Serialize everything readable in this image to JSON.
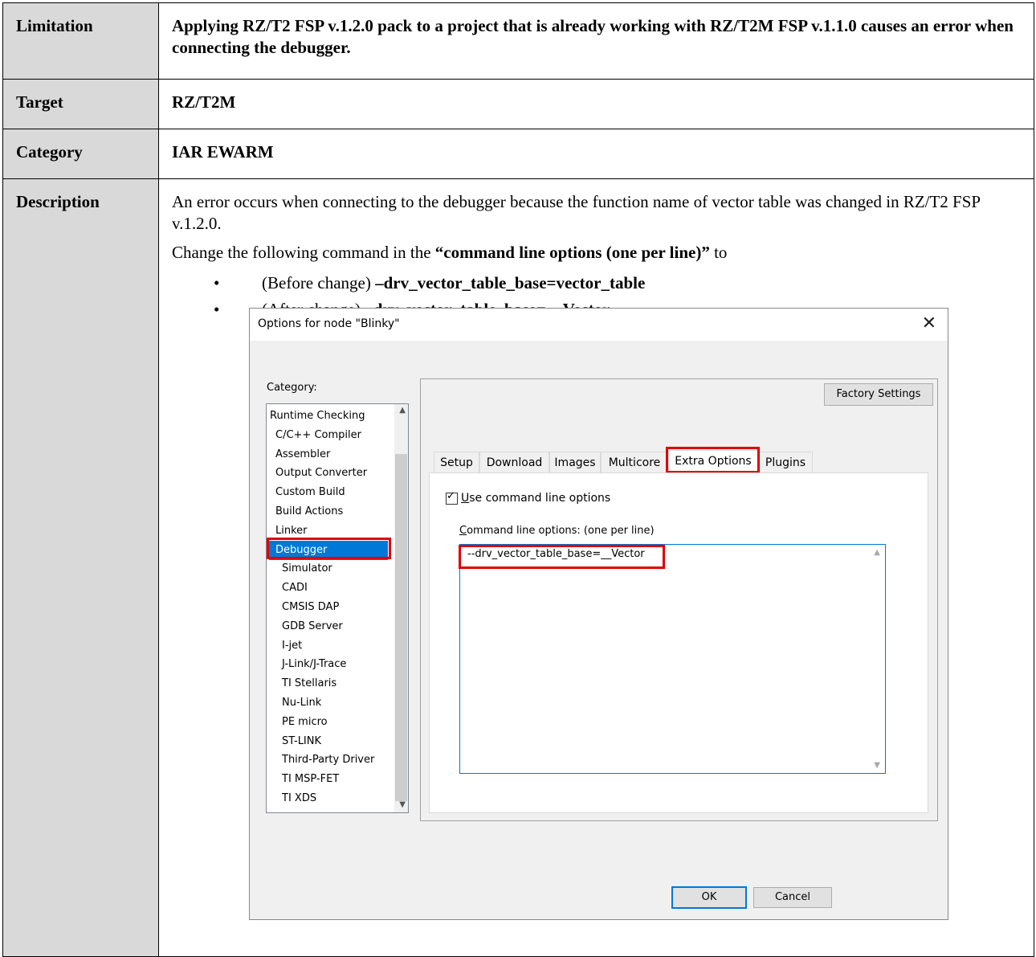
{
  "table": {
    "limitation": {
      "label": "Limitation",
      "value": "Applying RZ/T2 FSP v.1.2.0 pack to a project that is already working with RZ/T2M FSP v.1.1.0 causes an error when connecting the debugger."
    },
    "target": {
      "label": "Target",
      "value": "RZ/T2M"
    },
    "category": {
      "label": "Category",
      "value": "IAR EWARM"
    },
    "description": {
      "label": "Description",
      "para1": "An error occurs when connecting to the debugger because the function name of vector table was changed in RZ/T2 FSP v.1.2.0.",
      "para2_prefix": "Change the following command in the ",
      "para2_bold": "“command line options (one per line)”",
      "para2_suffix": " to",
      "bullets": [
        {
          "prefix": "(Before change) ",
          "bold": "–drv_vector_table_base=vector_table"
        },
        {
          "prefix": "(After change) ",
          "bold": "–drv_vector_table_base=__Vector"
        }
      ]
    }
  },
  "dialog": {
    "title": "Options for node \"Blinky\"",
    "close_glyph": "✕",
    "category_label": "Category:",
    "categories": [
      {
        "label": "Runtime Checking",
        "level": 0
      },
      {
        "label": "C/C++ Compiler",
        "level": 1
      },
      {
        "label": "Assembler",
        "level": 1
      },
      {
        "label": "Output Converter",
        "level": 1
      },
      {
        "label": "Custom Build",
        "level": 1
      },
      {
        "label": "Build Actions",
        "level": 1
      },
      {
        "label": "Linker",
        "level": 1
      },
      {
        "label": "Debugger",
        "level": 1,
        "selected": true
      },
      {
        "label": "Simulator",
        "level": 2
      },
      {
        "label": "CADI",
        "level": 2
      },
      {
        "label": "CMSIS DAP",
        "level": 2
      },
      {
        "label": "GDB Server",
        "level": 2
      },
      {
        "label": "I-jet",
        "level": 2
      },
      {
        "label": "J-Link/J-Trace",
        "level": 2
      },
      {
        "label": "TI Stellaris",
        "level": 2
      },
      {
        "label": "Nu-Link",
        "level": 2
      },
      {
        "label": "PE micro",
        "level": 2
      },
      {
        "label": "ST-LINK",
        "level": 2
      },
      {
        "label": "Third-Party Driver",
        "level": 2
      },
      {
        "label": "TI MSP-FET",
        "level": 2
      },
      {
        "label": "TI XDS",
        "level": 2
      }
    ],
    "factory_settings": "Factory Settings",
    "tabs": [
      "Setup",
      "Download",
      "Images",
      "Multicore",
      "Extra Options",
      "Plugins"
    ],
    "active_tab": "Extra Options",
    "use_cmd_line_u": "U",
    "use_cmd_line_rest": "se command line options",
    "cmd_label_u": "C",
    "cmd_label_rest": "ommand line options:  (one per line)",
    "cmd_value": "--drv_vector_table_base=__Vector",
    "ok": "OK",
    "cancel": "Cancel",
    "highlight_color": "#e00000",
    "selection_color": "#0078d7"
  }
}
